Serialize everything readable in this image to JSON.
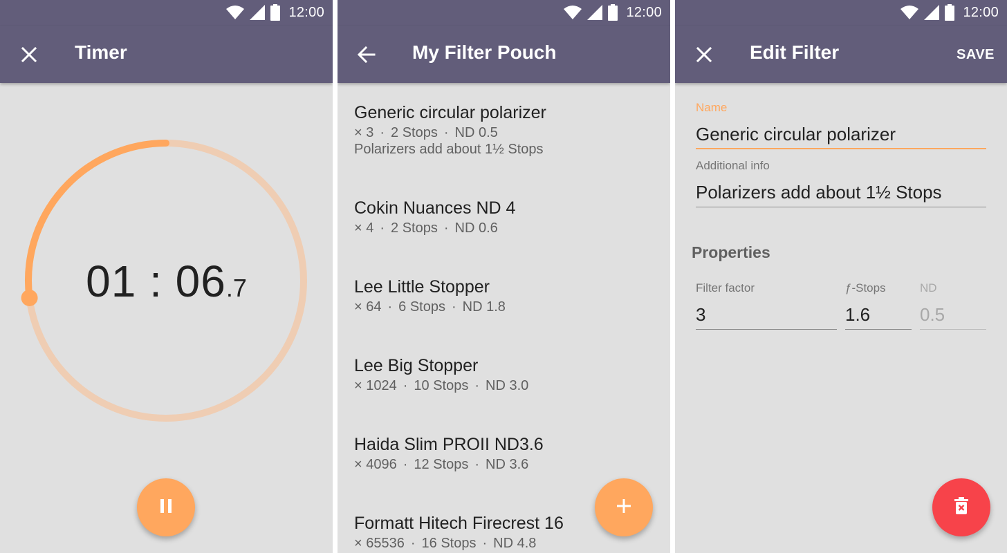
{
  "status_bar": {
    "time": "12:00"
  },
  "timer_screen": {
    "title": "Timer",
    "close_icon": "close-icon",
    "time_main": "01 : 06",
    "time_tenths": ".7",
    "progress_fraction": 0.27,
    "pause_icon": "pause-icon",
    "colors": {
      "accent": "#ffa75e",
      "track": "#efcdb3"
    }
  },
  "filter_pouch_screen": {
    "title": "My Filter Pouch",
    "back_icon": "arrow-back-icon",
    "add_icon": "add-icon",
    "items": [
      {
        "name": "Generic circular polarizer",
        "factor": "× 3",
        "stops": "2 Stops",
        "nd": "ND 0.5",
        "info": "Polarizers add about 1½ Stops"
      },
      {
        "name": "Cokin Nuances ND 4",
        "factor": "× 4",
        "stops": "2 Stops",
        "nd": "ND 0.6"
      },
      {
        "name": "Lee Little Stopper",
        "factor": "× 64",
        "stops": "6 Stops",
        "nd": "ND 1.8"
      },
      {
        "name": "Lee Big Stopper",
        "factor": "× 1024",
        "stops": "10 Stops",
        "nd": "ND 3.0"
      },
      {
        "name": "Haida Slim PROII ND3.6",
        "factor": "× 4096",
        "stops": "12 Stops",
        "nd": "ND 3.6"
      },
      {
        "name": "Formatt Hitech Firecrest 16",
        "factor": "× 65536",
        "stops": "16 Stops",
        "nd": "ND 4.8"
      }
    ],
    "separator": "·"
  },
  "edit_filter_screen": {
    "title": "Edit Filter",
    "close_icon": "close-icon",
    "save_label": "SAVE",
    "name_label": "Name",
    "name_value": "Generic circular polarizer",
    "info_label": "Additional info",
    "info_value": "Polarizers add about 1½ Stops",
    "properties_title": "Properties",
    "factor_label": "Filter factor",
    "factor_value": "3",
    "stops_label": "ƒ-Stops",
    "stops_value": "1.6",
    "nd_label": "ND",
    "nd_value": "0.5",
    "delete_icon": "delete-icon",
    "colors": {
      "accent": "#ffa75e",
      "danger": "#f7434a",
      "appbar": "#625d7a"
    }
  }
}
